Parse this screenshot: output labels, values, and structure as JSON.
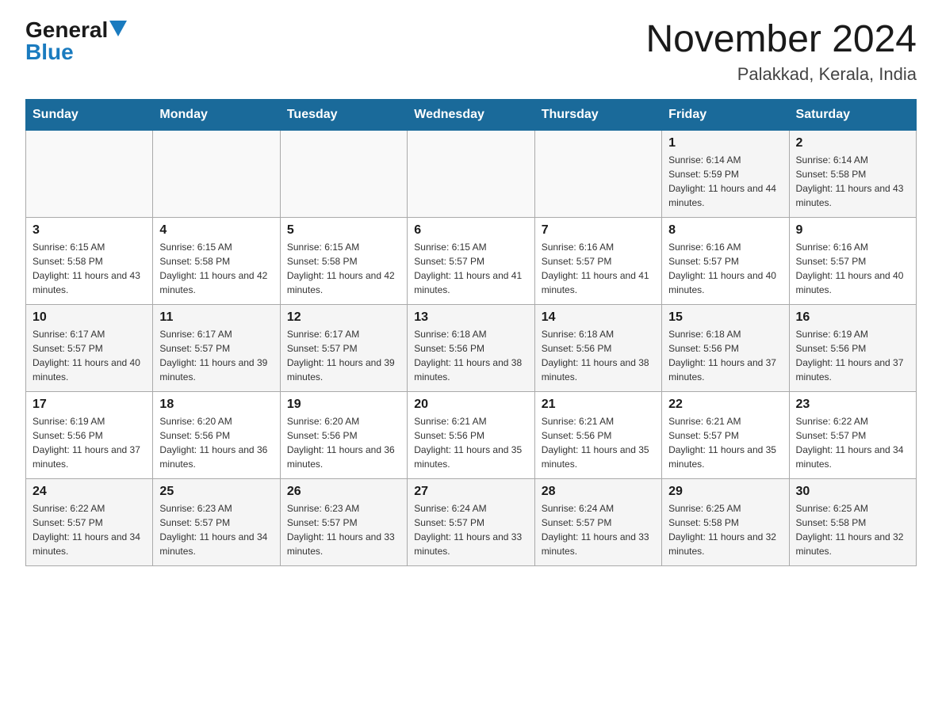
{
  "header": {
    "logo_general": "General",
    "logo_blue": "Blue",
    "month_title": "November 2024",
    "location": "Palakkad, Kerala, India"
  },
  "weekdays": [
    "Sunday",
    "Monday",
    "Tuesday",
    "Wednesday",
    "Thursday",
    "Friday",
    "Saturday"
  ],
  "weeks": [
    [
      {
        "day": "",
        "info": ""
      },
      {
        "day": "",
        "info": ""
      },
      {
        "day": "",
        "info": ""
      },
      {
        "day": "",
        "info": ""
      },
      {
        "day": "",
        "info": ""
      },
      {
        "day": "1",
        "info": "Sunrise: 6:14 AM\nSunset: 5:59 PM\nDaylight: 11 hours and 44 minutes."
      },
      {
        "day": "2",
        "info": "Sunrise: 6:14 AM\nSunset: 5:58 PM\nDaylight: 11 hours and 43 minutes."
      }
    ],
    [
      {
        "day": "3",
        "info": "Sunrise: 6:15 AM\nSunset: 5:58 PM\nDaylight: 11 hours and 43 minutes."
      },
      {
        "day": "4",
        "info": "Sunrise: 6:15 AM\nSunset: 5:58 PM\nDaylight: 11 hours and 42 minutes."
      },
      {
        "day": "5",
        "info": "Sunrise: 6:15 AM\nSunset: 5:58 PM\nDaylight: 11 hours and 42 minutes."
      },
      {
        "day": "6",
        "info": "Sunrise: 6:15 AM\nSunset: 5:57 PM\nDaylight: 11 hours and 41 minutes."
      },
      {
        "day": "7",
        "info": "Sunrise: 6:16 AM\nSunset: 5:57 PM\nDaylight: 11 hours and 41 minutes."
      },
      {
        "day": "8",
        "info": "Sunrise: 6:16 AM\nSunset: 5:57 PM\nDaylight: 11 hours and 40 minutes."
      },
      {
        "day": "9",
        "info": "Sunrise: 6:16 AM\nSunset: 5:57 PM\nDaylight: 11 hours and 40 minutes."
      }
    ],
    [
      {
        "day": "10",
        "info": "Sunrise: 6:17 AM\nSunset: 5:57 PM\nDaylight: 11 hours and 40 minutes."
      },
      {
        "day": "11",
        "info": "Sunrise: 6:17 AM\nSunset: 5:57 PM\nDaylight: 11 hours and 39 minutes."
      },
      {
        "day": "12",
        "info": "Sunrise: 6:17 AM\nSunset: 5:57 PM\nDaylight: 11 hours and 39 minutes."
      },
      {
        "day": "13",
        "info": "Sunrise: 6:18 AM\nSunset: 5:56 PM\nDaylight: 11 hours and 38 minutes."
      },
      {
        "day": "14",
        "info": "Sunrise: 6:18 AM\nSunset: 5:56 PM\nDaylight: 11 hours and 38 minutes."
      },
      {
        "day": "15",
        "info": "Sunrise: 6:18 AM\nSunset: 5:56 PM\nDaylight: 11 hours and 37 minutes."
      },
      {
        "day": "16",
        "info": "Sunrise: 6:19 AM\nSunset: 5:56 PM\nDaylight: 11 hours and 37 minutes."
      }
    ],
    [
      {
        "day": "17",
        "info": "Sunrise: 6:19 AM\nSunset: 5:56 PM\nDaylight: 11 hours and 37 minutes."
      },
      {
        "day": "18",
        "info": "Sunrise: 6:20 AM\nSunset: 5:56 PM\nDaylight: 11 hours and 36 minutes."
      },
      {
        "day": "19",
        "info": "Sunrise: 6:20 AM\nSunset: 5:56 PM\nDaylight: 11 hours and 36 minutes."
      },
      {
        "day": "20",
        "info": "Sunrise: 6:21 AM\nSunset: 5:56 PM\nDaylight: 11 hours and 35 minutes."
      },
      {
        "day": "21",
        "info": "Sunrise: 6:21 AM\nSunset: 5:56 PM\nDaylight: 11 hours and 35 minutes."
      },
      {
        "day": "22",
        "info": "Sunrise: 6:21 AM\nSunset: 5:57 PM\nDaylight: 11 hours and 35 minutes."
      },
      {
        "day": "23",
        "info": "Sunrise: 6:22 AM\nSunset: 5:57 PM\nDaylight: 11 hours and 34 minutes."
      }
    ],
    [
      {
        "day": "24",
        "info": "Sunrise: 6:22 AM\nSunset: 5:57 PM\nDaylight: 11 hours and 34 minutes."
      },
      {
        "day": "25",
        "info": "Sunrise: 6:23 AM\nSunset: 5:57 PM\nDaylight: 11 hours and 34 minutes."
      },
      {
        "day": "26",
        "info": "Sunrise: 6:23 AM\nSunset: 5:57 PM\nDaylight: 11 hours and 33 minutes."
      },
      {
        "day": "27",
        "info": "Sunrise: 6:24 AM\nSunset: 5:57 PM\nDaylight: 11 hours and 33 minutes."
      },
      {
        "day": "28",
        "info": "Sunrise: 6:24 AM\nSunset: 5:57 PM\nDaylight: 11 hours and 33 minutes."
      },
      {
        "day": "29",
        "info": "Sunrise: 6:25 AM\nSunset: 5:58 PM\nDaylight: 11 hours and 32 minutes."
      },
      {
        "day": "30",
        "info": "Sunrise: 6:25 AM\nSunset: 5:58 PM\nDaylight: 11 hours and 32 minutes."
      }
    ]
  ]
}
